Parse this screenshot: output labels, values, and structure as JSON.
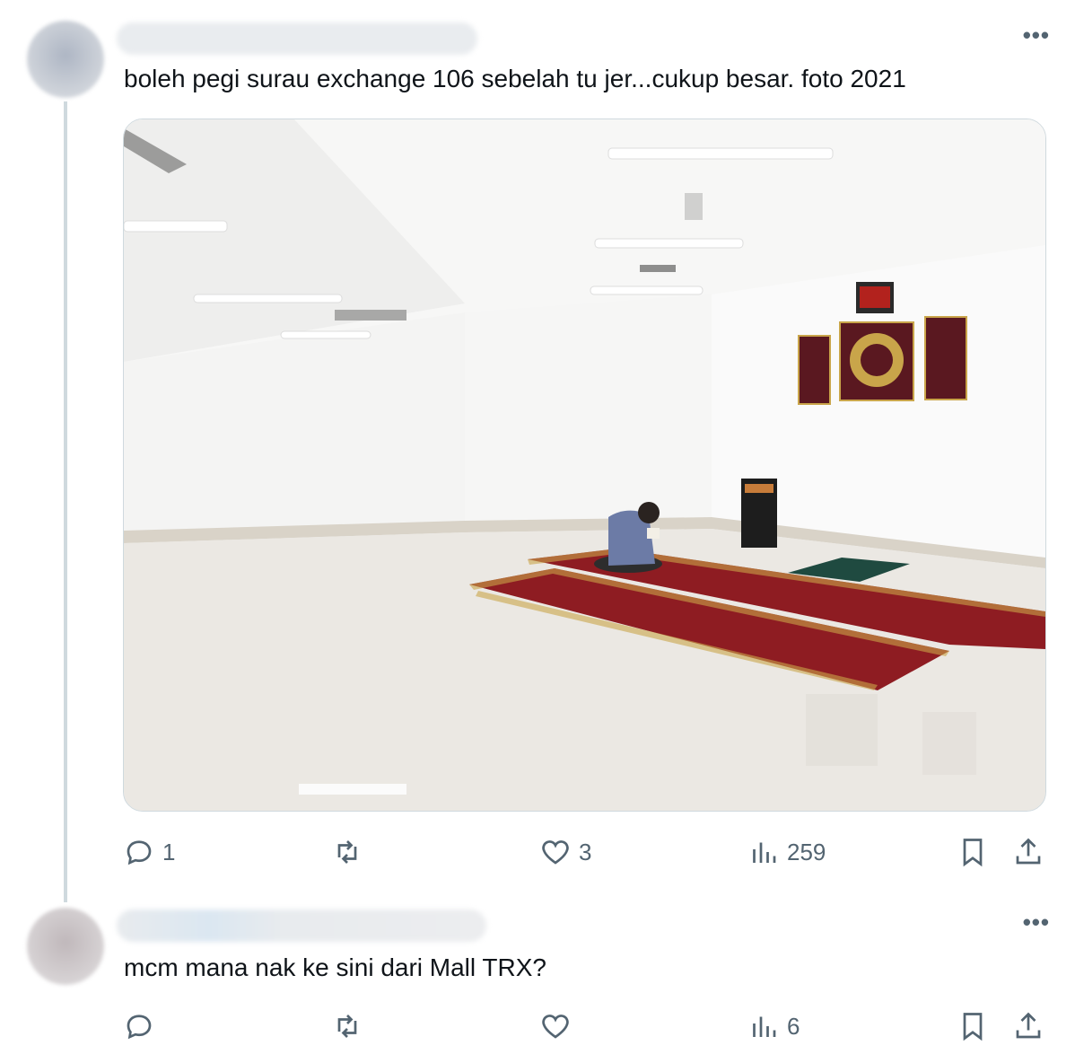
{
  "tweets": [
    {
      "author_redacted": true,
      "text": "boleh pegi surau exchange 106 sebelah tu jer...cukup besar. foto 2021",
      "more_label": "•••",
      "image": {
        "alt_subject": "prayer room photo: man seated reading on red prayer carpets in white room, framed calligraphy on wall",
        "colors": {
          "wall": "#f6f6f5",
          "floor": "#e9e7e2",
          "carpet": "#8e1c22",
          "frame": "#5a1820",
          "gold": "#c9a54a"
        }
      },
      "actions": {
        "reply": "1",
        "retweet": "",
        "like": "3",
        "views": "259"
      }
    },
    {
      "author_redacted": true,
      "text": "mcm mana nak ke sini dari Mall TRX?",
      "more_label": "•••",
      "actions": {
        "reply": "",
        "retweet": "",
        "like": "",
        "views": "6"
      }
    }
  ],
  "icons": [
    "reply-icon",
    "retweet-icon",
    "like-icon",
    "views-icon",
    "bookmark-icon",
    "share-icon",
    "more-icon"
  ]
}
